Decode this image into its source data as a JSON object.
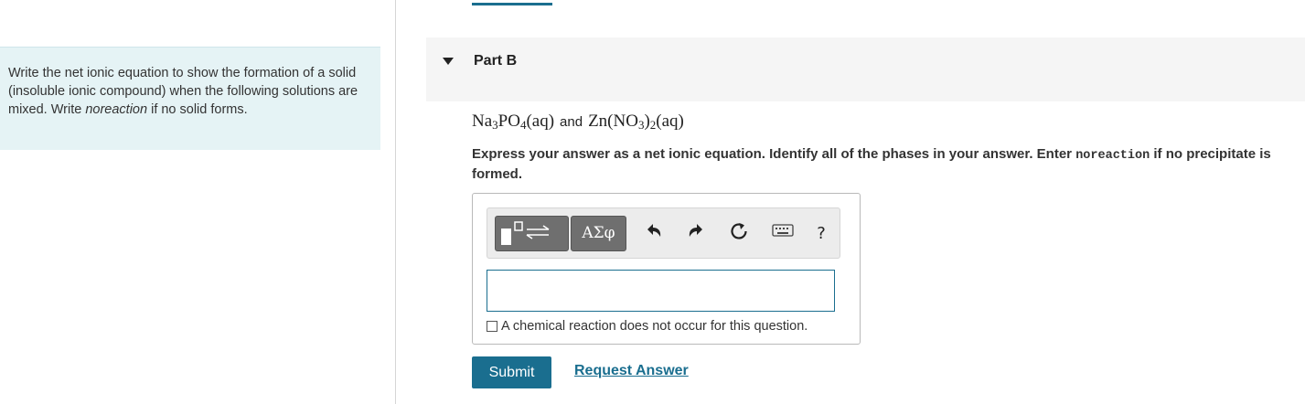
{
  "instructions": {
    "part1": "Write the net ionic equation to show the formation of a solid (insoluble ionic compound) when the following solutions are mixed. Write ",
    "italic": "noreaction",
    "part2": " if no solid forms."
  },
  "part": {
    "title": "Part B"
  },
  "reactants": {
    "r1": {
      "na": "Na",
      "na_sub": "3",
      "po": "PO",
      "po_sub": "4",
      "phase": "(aq)"
    },
    "and": "and",
    "r2": {
      "zn": "Zn(NO",
      "no_sub": "3",
      "close": ")",
      "close_sub": "2",
      "phase": "(aq)"
    }
  },
  "prompt": {
    "text": "Express your answer as a net ionic equation. Identify all of the phases in your answer. Enter ",
    "code": "noreaction",
    "tail": " if no precipitate is formed."
  },
  "toolbar": {
    "greek_label": "ΑΣφ",
    "help_label": "?",
    "icons": [
      "templates-icon",
      "greek-letters-icon",
      "undo-icon",
      "redo-icon",
      "reset-icon",
      "keyboard-icon",
      "help-icon"
    ]
  },
  "answer": {
    "value": ""
  },
  "no_reaction_label": "A chemical reaction does not occur for this question.",
  "actions": {
    "submit_label": "Submit",
    "request_label": "Request Answer"
  },
  "colors": {
    "accent": "#1a6e8f",
    "left_panel_bg": "#e5f3f5",
    "header_bg": "#f5f5f5"
  }
}
